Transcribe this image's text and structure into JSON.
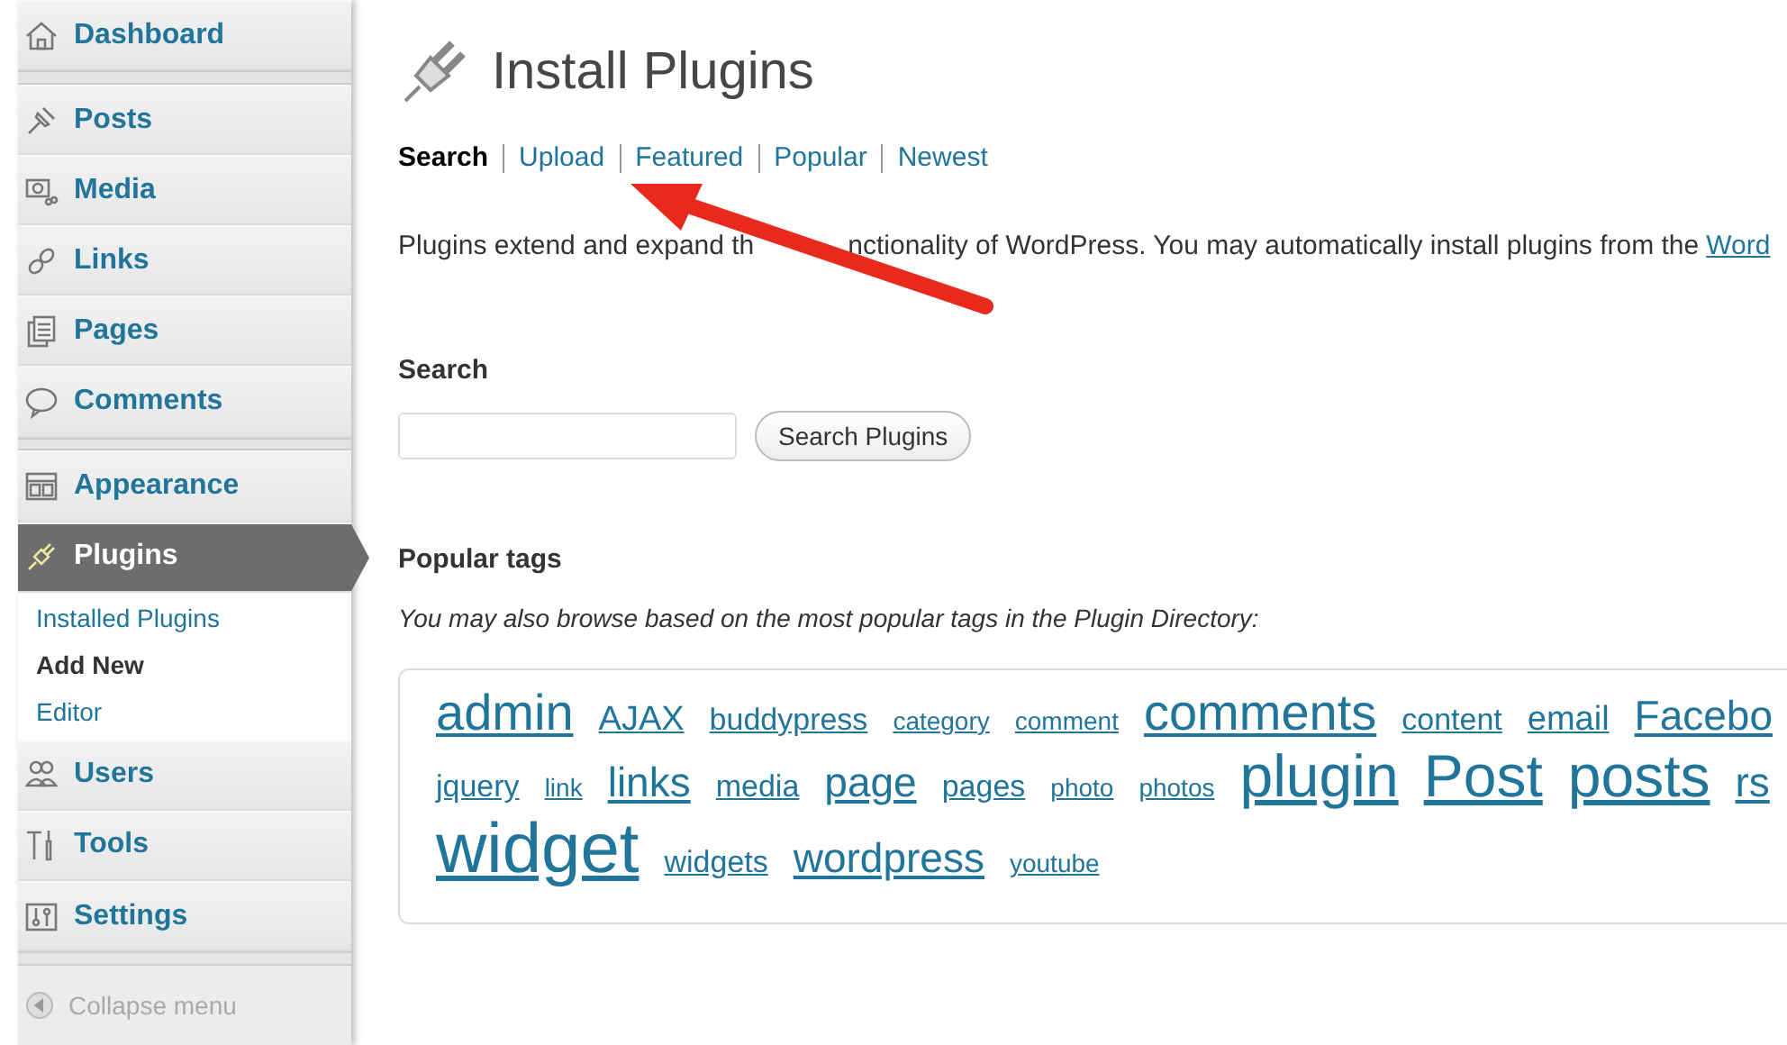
{
  "sidebar": {
    "groups": [
      [
        {
          "label": "Dashboard",
          "selected": false
        }
      ],
      [
        {
          "label": "Posts",
          "selected": false
        },
        {
          "label": "Media",
          "selected": false
        },
        {
          "label": "Links",
          "selected": false
        },
        {
          "label": "Pages",
          "selected": false
        },
        {
          "label": "Comments",
          "selected": false
        }
      ],
      [
        {
          "label": "Appearance",
          "selected": false
        },
        {
          "label": "Plugins",
          "selected": true,
          "children": [
            {
              "label": "Installed Plugins",
              "selected": false
            },
            {
              "label": "Add New",
              "selected": true
            },
            {
              "label": "Editor",
              "selected": false
            }
          ]
        },
        {
          "label": "Users",
          "selected": false
        },
        {
          "label": "Tools",
          "selected": false
        },
        {
          "label": "Settings",
          "selected": false
        }
      ]
    ],
    "collapse": "Collapse menu"
  },
  "page": {
    "title": "Install Plugins",
    "tabs": [
      {
        "label": "Search",
        "selected": true
      },
      {
        "label": "Upload",
        "selected": false
      },
      {
        "label": "Featured",
        "selected": false
      },
      {
        "label": "Popular",
        "selected": false
      },
      {
        "label": "Newest",
        "selected": false
      }
    ],
    "intro": "Plugins extend and expand th",
    "intro_rest": "nctionality of WordPress. You may automatically install plugins from the",
    "intro_link": "Word",
    "search": {
      "heading": "Search",
      "button": "Search Plugins"
    },
    "tags": {
      "heading": "Popular tags",
      "note": "You may also browse based on the most popular tags in the Plugin Directory:",
      "lines": [
        [
          {
            "label": "admin",
            "kind": "xl"
          },
          {
            "label": "AJAX",
            "kind": "m"
          },
          {
            "label": "buddypress",
            "kind": "s"
          },
          {
            "label": "category",
            "kind": "xs"
          },
          {
            "label": "comment",
            "kind": "xs"
          },
          {
            "label": "comments",
            "kind": "xl"
          },
          {
            "label": "content",
            "kind": "s"
          },
          {
            "label": "email",
            "kind": "m"
          },
          {
            "label": "Facebo",
            "kind": "l"
          }
        ],
        [
          {
            "label": "jquery",
            "kind": "s"
          },
          {
            "label": "link",
            "kind": "xs"
          },
          {
            "label": "links",
            "kind": "l"
          },
          {
            "label": "media",
            "kind": "s"
          },
          {
            "label": "page",
            "kind": "l"
          },
          {
            "label": "pages",
            "kind": "s"
          },
          {
            "label": "photo",
            "kind": "xs"
          },
          {
            "label": "photos",
            "kind": "xs"
          },
          {
            "label": "plugin",
            "kind": "xxl"
          },
          {
            "label": "Post",
            "kind": "xxl"
          },
          {
            "label": "posts",
            "kind": "xxl"
          },
          {
            "label": "rs",
            "kind": "l"
          }
        ],
        [
          {
            "label": "widget",
            "kind": "xxxl"
          },
          {
            "label": "widgets",
            "kind": "s"
          },
          {
            "label": "wordpress",
            "kind": "l"
          },
          {
            "label": "youtube",
            "kind": "xs"
          }
        ]
      ]
    }
  },
  "annotation": {
    "kind": "arrow"
  }
}
